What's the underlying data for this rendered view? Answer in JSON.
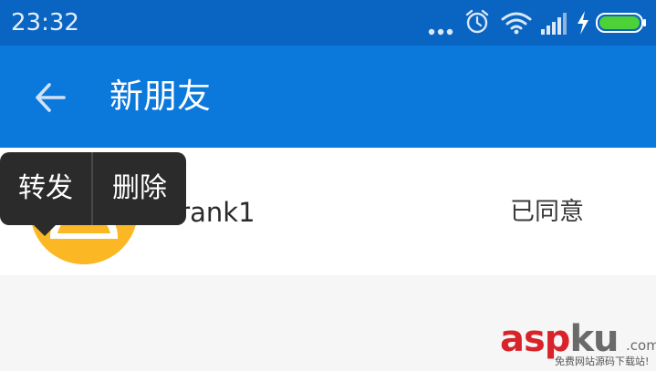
{
  "status_bar": {
    "time": "23:32",
    "icons": [
      "more-dots-icon",
      "alarm-clock-icon",
      "wifi-icon",
      "signal-icon",
      "charging-icon",
      "battery-icon"
    ],
    "battery_color": "#4cd137"
  },
  "header": {
    "title": "新朋友",
    "back_icon": "arrow-left-icon",
    "color": "#0b78dc"
  },
  "friend_request": {
    "username": "frank1",
    "status": "已同意",
    "avatar_color": "#fbb824"
  },
  "context_menu": {
    "items": [
      {
        "label": "转发"
      },
      {
        "label": "删除"
      }
    ]
  },
  "watermark": {
    "brand_asp": "asp",
    "brand_ku": "ku",
    "domain_suffix": ".com",
    "tagline": "免费网站源码下载站!"
  }
}
